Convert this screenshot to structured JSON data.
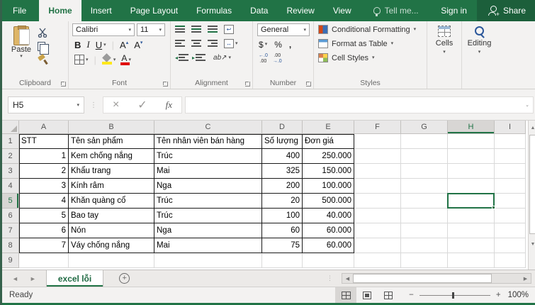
{
  "colors": {
    "brand_green": "#217346",
    "share_bg": "#1c5f3b",
    "ribbon_bg": "#f3f2f1",
    "selection_border": "#217346",
    "fill_color_swatch": "#ffe81a",
    "font_color_swatch": "#e00000",
    "table_border": "#1a1a1a"
  },
  "titlebar": {
    "tabs": [
      "File",
      "Home",
      "Insert",
      "Page Layout",
      "Formulas",
      "Data",
      "Review",
      "View"
    ],
    "active_tab": "Home",
    "tell_me": "Tell me...",
    "sign_in": "Sign in",
    "share": "Share"
  },
  "ribbon": {
    "clipboard": {
      "group_label": "Clipboard",
      "paste_label": "Paste"
    },
    "font": {
      "group_label": "Font",
      "font_name": "Calibri",
      "font_size": "11",
      "bold": "B",
      "italic": "I",
      "underline": "U",
      "grow_font": "A",
      "shrink_font": "A"
    },
    "alignment": {
      "group_label": "Alignment",
      "orientation": "ab",
      "wrap_glyph": "↩",
      "merge_glyph": "↔"
    },
    "number": {
      "group_label": "Number",
      "number_format": "General",
      "currency": "$",
      "percent": "%",
      "comma": ",",
      "inc_decimal_top": "←.0",
      "inc_decimal_bottom": ".00",
      "dec_decimal_top": ".00",
      "dec_decimal_bottom": "→.0"
    },
    "styles": {
      "group_label": "Styles",
      "items": [
        "Conditional Formatting",
        "Format as Table",
        "Cell Styles"
      ]
    },
    "cells": {
      "group_label": "Cells"
    },
    "editing": {
      "group_label": "Editing"
    }
  },
  "formula_bar": {
    "name_box": "H5",
    "cancel": "×",
    "enter": "✓",
    "fx": "fx",
    "value": ""
  },
  "grid": {
    "column_letters": [
      "A",
      "B",
      "C",
      "D",
      "E",
      "F",
      "G",
      "H",
      "I"
    ],
    "row_numbers": [
      "1",
      "2",
      "3",
      "4",
      "5",
      "6",
      "7",
      "8",
      "9"
    ],
    "selected_cell": "H5",
    "selected_column": "H",
    "selected_row": "5",
    "table": {
      "headers": [
        "STT",
        "Tên sản phẩm",
        "Tên nhân viên bán hàng",
        "Số lượng",
        "Đơn giá"
      ],
      "rows": [
        [
          "1",
          "Kem chống nắng",
          "Trúc",
          "400",
          "250.000"
        ],
        [
          "2",
          "Khẩu trang",
          "Mai",
          "325",
          "150.000"
        ],
        [
          "3",
          "Kính râm",
          "Nga",
          "200",
          "100.000"
        ],
        [
          "4",
          "Khăn quàng cổ",
          "Trúc",
          "20",
          "500.000"
        ],
        [
          "5",
          "Bao tay",
          "Trúc",
          "100",
          "40.000"
        ],
        [
          "6",
          "Nón",
          "Nga",
          "60",
          "60.000"
        ],
        [
          "7",
          "Váy chống nắng",
          "Mai",
          "75",
          "60.000"
        ]
      ]
    }
  },
  "sheet_tabs": {
    "active_tab": "excel lỗi"
  },
  "status_bar": {
    "status": "Ready",
    "zoom_level": "100%"
  }
}
